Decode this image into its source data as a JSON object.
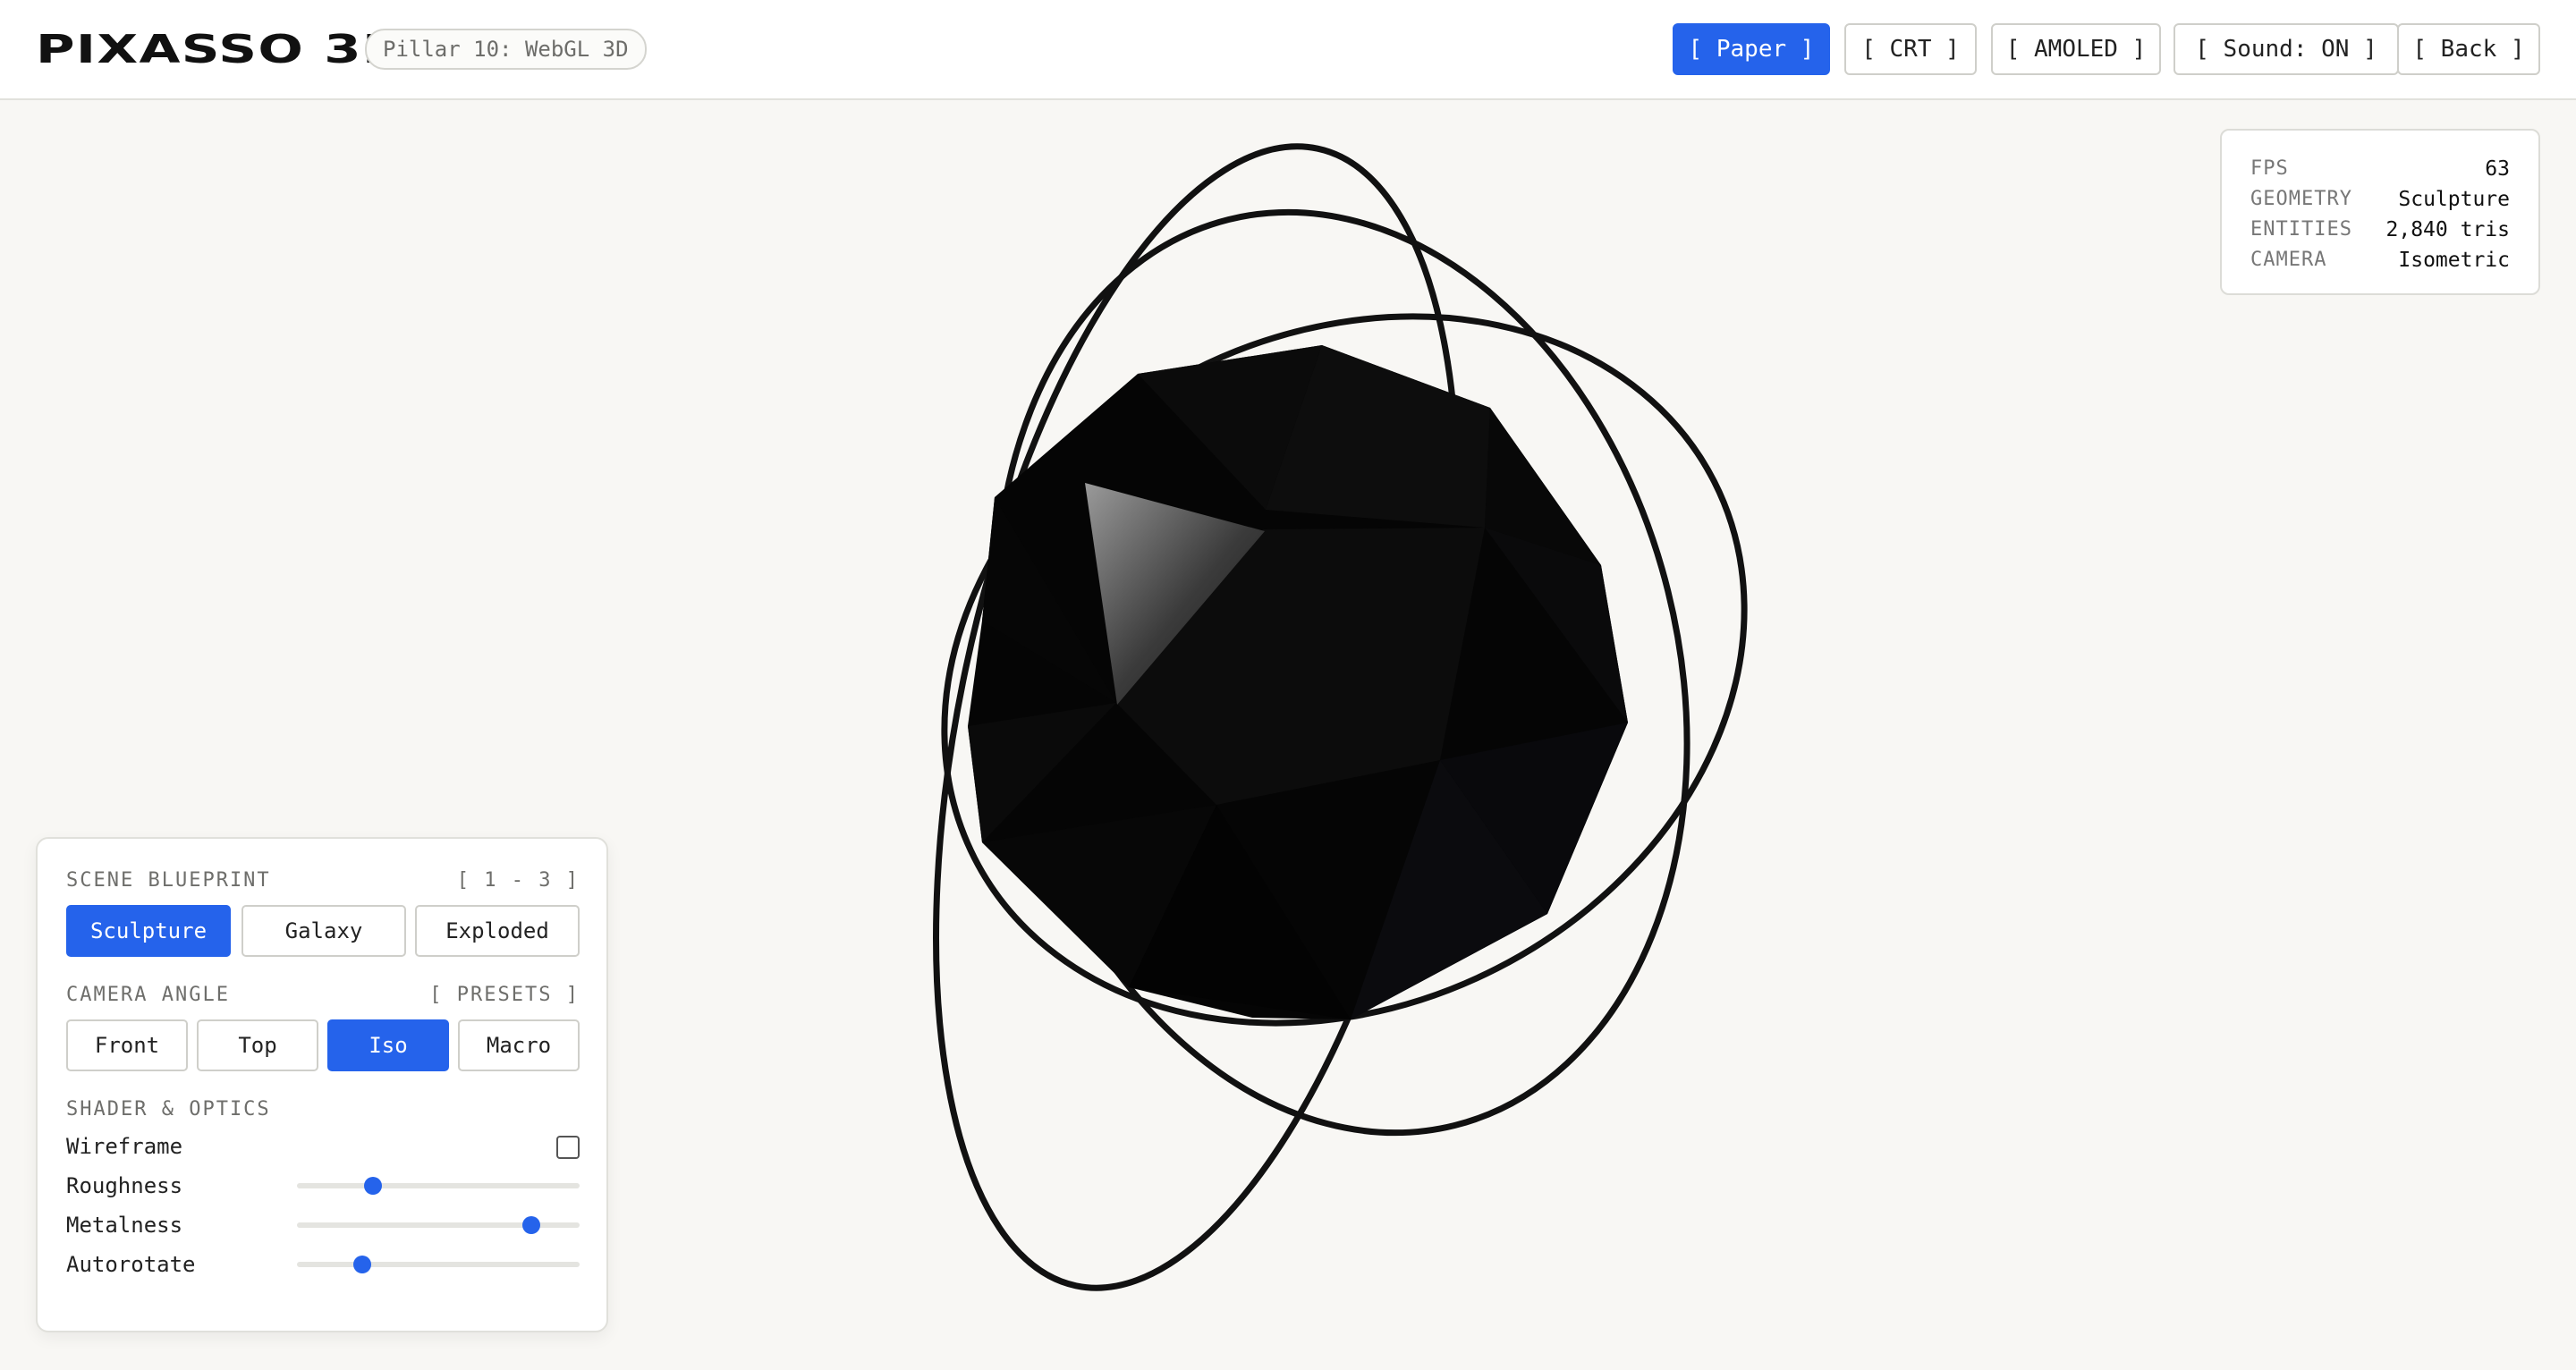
{
  "header": {
    "logo": "PIXASSO 3D",
    "pillar_badge": "Pillar 10: WebGL 3D",
    "theme_buttons": [
      {
        "label": "[ Paper ]",
        "active": true
      },
      {
        "label": "[ CRT ]",
        "active": false
      },
      {
        "label": "[ AMOLED ]",
        "active": false
      },
      {
        "label": "[ Sound: ON ]",
        "active": false
      },
      {
        "label": "[ Back ]",
        "active": false
      }
    ]
  },
  "stats": {
    "rows": [
      {
        "key": "FPS",
        "value": "63"
      },
      {
        "key": "GEOMETRY",
        "value": "Sculpture"
      },
      {
        "key": "ENTITIES",
        "value": "2,840 tris"
      },
      {
        "key": "CAMERA",
        "value": "Isometric"
      }
    ]
  },
  "panel": {
    "scene": {
      "title": "SCENE BLUEPRINT",
      "hint": "[ 1 - 3 ]",
      "options": [
        "Sculpture",
        "Galaxy",
        "Exploded"
      ],
      "selected": "Sculpture"
    },
    "camera": {
      "title": "CAMERA ANGLE",
      "hint": "[ PRESETS ]",
      "options": [
        "Front",
        "Top",
        "Iso",
        "Macro"
      ],
      "selected": "Iso"
    },
    "shader": {
      "title": "SHADER & OPTICS",
      "wireframe_label": "Wireframe",
      "wireframe_checked": false,
      "sliders": [
        {
          "label": "Roughness",
          "value": 0.27
        },
        {
          "label": "Metalness",
          "value": 0.83
        },
        {
          "label": "Autorotate",
          "value": 0.23
        }
      ]
    }
  },
  "colors": {
    "accent": "#2563eb",
    "background": "#f8f7f4",
    "object": "#050505"
  }
}
